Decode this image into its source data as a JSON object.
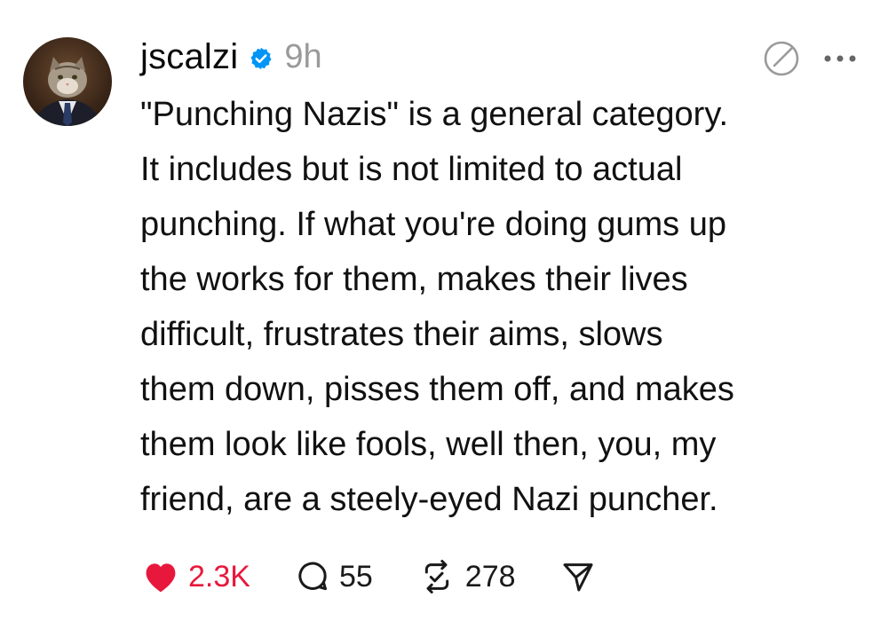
{
  "post": {
    "username": "jscalzi",
    "timestamp": "9h",
    "verified": true,
    "text": "\"Punching Nazis\" is a general category.\nIt includes but is not limited to actual\npunching. If what you're doing gums up\nthe works for them, makes their lives\ndifficult, frustrates their aims, slows\nthem down, pisses them off, and makes\nthem look like fools, well then, you, my\nfriend, are a steely-eyed Nazi puncher.",
    "actions": {
      "likes": "2.3K",
      "replies": "55",
      "reposts": "278"
    }
  },
  "colors": {
    "like": "#e8183c",
    "verified": "#0095f6",
    "timestamp": "#9a9a9a"
  },
  "icons": {
    "avatar": "cat-in-suit-avatar",
    "verified": "verified-badge-icon",
    "threads": "threads-logo-icon",
    "more": "more-horizontal-icon",
    "like": "heart-icon",
    "reply": "comment-bubble-icon",
    "repost": "repost-icon",
    "share": "send-icon"
  }
}
